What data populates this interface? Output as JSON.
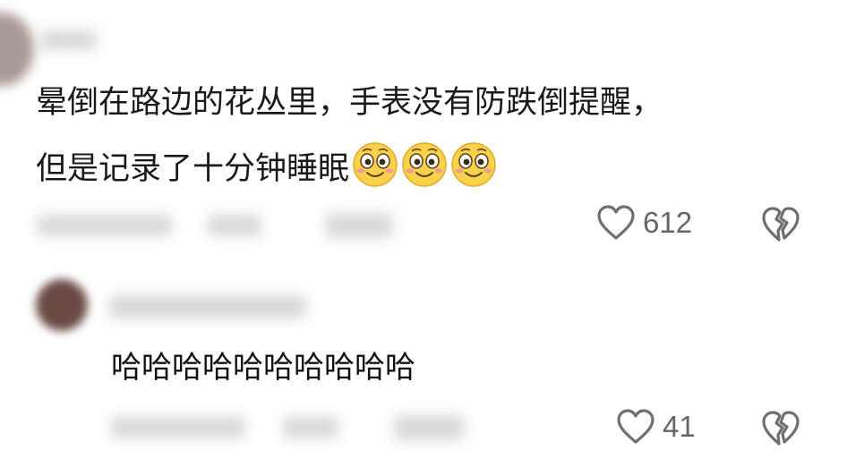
{
  "comments": [
    {
      "text_line1": "晕倒在路边的花丛里，手表没有防跌倒提醒，",
      "text_line2": "但是记录了十分钟睡眠",
      "emojis": [
        "smiley-face-icon",
        "smiley-face-icon",
        "smiley-face-icon"
      ],
      "likes": "612"
    },
    {
      "text": "哈哈哈哈哈哈哈哈哈哈",
      "likes": "41"
    }
  ],
  "colors": {
    "text": "#1a1a1a",
    "icon": "#6f6f6f",
    "emoji_face": "#f8d24a",
    "emoji_cheek": "#f39a9a"
  }
}
